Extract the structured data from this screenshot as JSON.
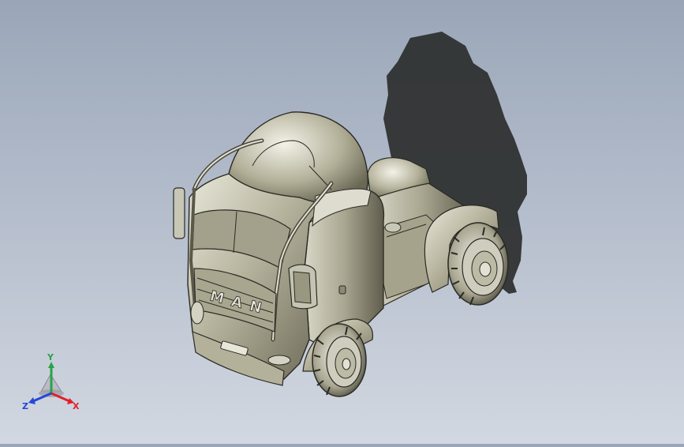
{
  "viewport": {
    "model_badge_text": "MAN",
    "colors": {
      "bg_top": "#9aa6b8",
      "bg_bottom": "#d2d8e1",
      "shadow": "#2f3132",
      "body": "#b9b7a1",
      "body_dark": "#6f6c5a",
      "body_light": "#e6e4d6",
      "edge": "#2a2a24"
    }
  },
  "triad": {
    "x_label": "X",
    "y_label": "Y",
    "z_label": "Z",
    "x_color": "#e0202a",
    "y_color": "#2aa24a",
    "z_color": "#2447d6"
  }
}
